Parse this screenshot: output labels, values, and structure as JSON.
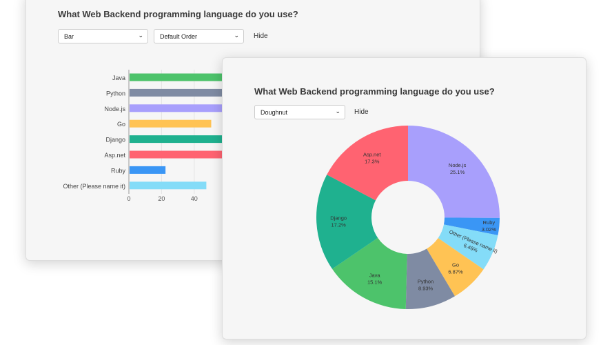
{
  "back_panel": {
    "title": "What Web Backend programming language do you use?",
    "chart_type_select": "Bar",
    "order_select": "Default Order",
    "hide_label": "Hide"
  },
  "front_panel": {
    "title": "What Web Backend programming language do you use?",
    "chart_type_select": "Doughnut",
    "hide_label": "Hide"
  },
  "chart_data": [
    {
      "type": "bar",
      "orientation": "horizontal",
      "categories": [
        "Java",
        "Python",
        "Node.js",
        "Go",
        "Django",
        "Asp.net",
        "Ruby",
        "Other (Please name it)"
      ],
      "values": [
        110,
        65,
        183,
        50,
        125,
        126,
        22,
        47
      ],
      "xticks": [
        "0",
        "20",
        "40"
      ],
      "colors": [
        "#4dc36b",
        "#7f8ba3",
        "#a89ffc",
        "#ffc354",
        "#1fb18f",
        "#ff6371",
        "#3a96f5",
        "#84dcf8"
      ]
    },
    {
      "type": "pie",
      "variant": "doughnut",
      "categories": [
        "Node.js",
        "Ruby",
        "Other (Please name it)",
        "Go",
        "Python",
        "Java",
        "Django",
        "Asp.net"
      ],
      "values": [
        25.1,
        3.02,
        6.46,
        6.87,
        8.93,
        15.1,
        17.2,
        17.3
      ],
      "labels": [
        "25.1%",
        "3.02%",
        "6.46%",
        "6.87%",
        "8.93%",
        "15.1%",
        "17.2%",
        "17.3%"
      ],
      "colors": [
        "#a89ffc",
        "#3a96f5",
        "#84dcf8",
        "#ffc354",
        "#7f8ba3",
        "#4dc36b",
        "#1fb18f",
        "#ff6371"
      ]
    }
  ]
}
